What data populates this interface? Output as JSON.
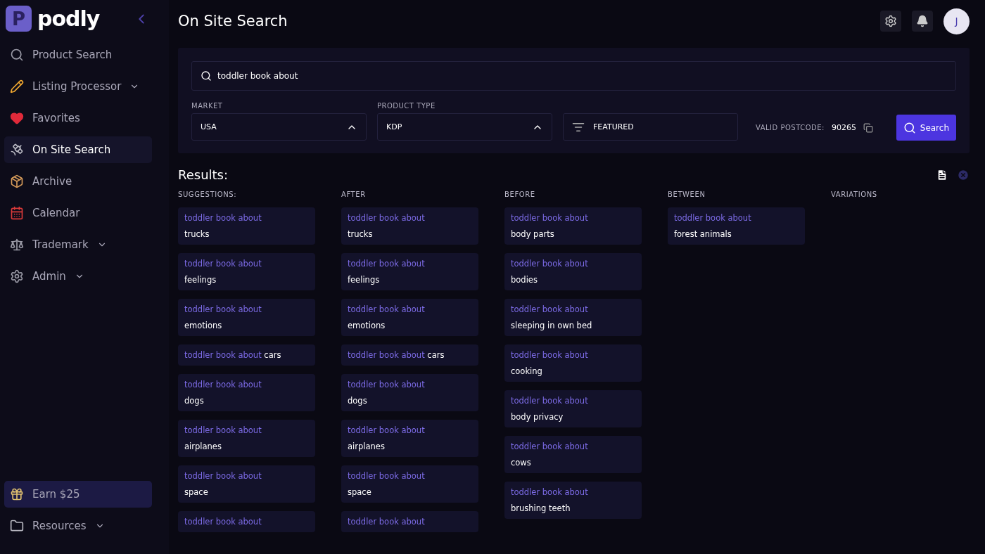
{
  "brand": {
    "initial": "P",
    "name": "podly"
  },
  "sidebar": {
    "items": [
      {
        "label": "Product Search",
        "selected": false,
        "expandable": false
      },
      {
        "label": "Listing Processor",
        "selected": false,
        "expandable": true
      },
      {
        "label": "Favorites",
        "selected": false,
        "expandable": false
      },
      {
        "label": "On Site Search",
        "selected": true,
        "expandable": false
      },
      {
        "label": "Archive",
        "selected": false,
        "expandable": false
      },
      {
        "label": "Calendar",
        "selected": false,
        "expandable": false
      },
      {
        "label": "Trademark",
        "selected": false,
        "expandable": true
      },
      {
        "label": "Admin",
        "selected": false,
        "expandable": true
      }
    ],
    "bottom_items": [
      {
        "label": "Earn $25",
        "selected": true,
        "expandable": false
      },
      {
        "label": "Resources",
        "selected": false,
        "expandable": true
      }
    ]
  },
  "header": {
    "title": "On Site Search",
    "avatar": "J"
  },
  "search": {
    "value": "toddler book about",
    "market": {
      "label": "MARKET",
      "value": "USA"
    },
    "product_type": {
      "label": "PRODUCT TYPE",
      "value": "KDP"
    },
    "sort": "FEATURED",
    "postcode_label": "VALID POSTCODE:",
    "postcode": "90265",
    "button": "Search"
  },
  "results": {
    "title": "Results:",
    "columns": [
      {
        "heading": "SUGGESTIONS:",
        "cards": [
          {
            "kind": "stacked",
            "prefix": "toddler book about",
            "suffix": "trucks"
          },
          {
            "kind": "stacked",
            "prefix": "toddler book about",
            "suffix": "feelings"
          },
          {
            "kind": "stacked",
            "prefix": "toddler book about",
            "suffix": "emotions"
          },
          {
            "kind": "inline",
            "prefix": "toddler book about",
            "suffix": "cars"
          },
          {
            "kind": "stacked",
            "prefix": "toddler book about",
            "suffix": "dogs"
          },
          {
            "kind": "stacked",
            "prefix": "toddler book about",
            "suffix": "airplanes"
          },
          {
            "kind": "stacked",
            "prefix": "toddler book about",
            "suffix": "space"
          },
          {
            "kind": "stacked",
            "prefix": "toddler book about"
          }
        ]
      },
      {
        "heading": "AFTER",
        "cards": [
          {
            "kind": "stacked",
            "prefix": "toddler book about",
            "suffix": "trucks"
          },
          {
            "kind": "stacked",
            "prefix": "toddler book about",
            "suffix": "feelings"
          },
          {
            "kind": "stacked",
            "prefix": "toddler book about",
            "suffix": "emotions"
          },
          {
            "kind": "inline",
            "prefix": "toddler book about",
            "suffix": "cars"
          },
          {
            "kind": "stacked",
            "prefix": "toddler book about",
            "suffix": "dogs"
          },
          {
            "kind": "stacked",
            "prefix": "toddler book about",
            "suffix": "airplanes"
          },
          {
            "kind": "stacked",
            "prefix": "toddler book about",
            "suffix": "space"
          },
          {
            "kind": "stacked",
            "prefix": "toddler book about"
          }
        ]
      },
      {
        "heading": "BEFORE",
        "cards": [
          {
            "kind": "stacked",
            "prefix": "toddler book about",
            "suffix": "body parts"
          },
          {
            "kind": "stacked",
            "prefix": "toddler book about",
            "suffix": "bodies"
          },
          {
            "kind": "stacked",
            "prefix": "toddler book about",
            "suffix": "sleeping in own bed"
          },
          {
            "kind": "stacked",
            "prefix": "toddler book about",
            "suffix": "cooking"
          },
          {
            "kind": "stacked",
            "prefix": "toddler book about",
            "suffix": "body privacy"
          },
          {
            "kind": "stacked",
            "prefix": "toddler book about",
            "suffix": "cows"
          },
          {
            "kind": "stacked",
            "prefix": "toddler book about",
            "suffix": "brushing teeth"
          }
        ]
      },
      {
        "heading": "BETWEEN",
        "cards": [
          {
            "kind": "stacked",
            "prefix": "toddler book about",
            "suffix": "forest animals"
          }
        ]
      },
      {
        "heading": "VARIATIONS"
      }
    ]
  }
}
